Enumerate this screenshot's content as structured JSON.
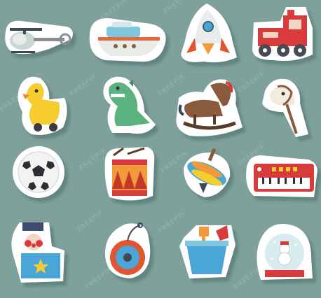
{
  "watermark": "FREEPIK",
  "colors": {
    "background": "#7fa19b",
    "sticker_border": "#ffffff",
    "sticker_shadow": "#5a7a75"
  },
  "stickers": [
    {
      "icon": "helicopter-icon"
    },
    {
      "icon": "boat-icon"
    },
    {
      "icon": "rocket-icon"
    },
    {
      "icon": "train-icon"
    },
    {
      "icon": "rubber-duck-icon"
    },
    {
      "icon": "dinosaur-icon"
    },
    {
      "icon": "rocking-horse-icon"
    },
    {
      "icon": "hobby-horse-icon"
    },
    {
      "icon": "soccer-ball-icon"
    },
    {
      "icon": "drum-icon"
    },
    {
      "icon": "spinning-top-icon"
    },
    {
      "icon": "keyboard-piano-icon"
    },
    {
      "icon": "jack-in-the-box-icon"
    },
    {
      "icon": "yo-yo-icon"
    },
    {
      "icon": "sand-bucket-icon"
    },
    {
      "icon": "snow-globe-icon"
    }
  ]
}
